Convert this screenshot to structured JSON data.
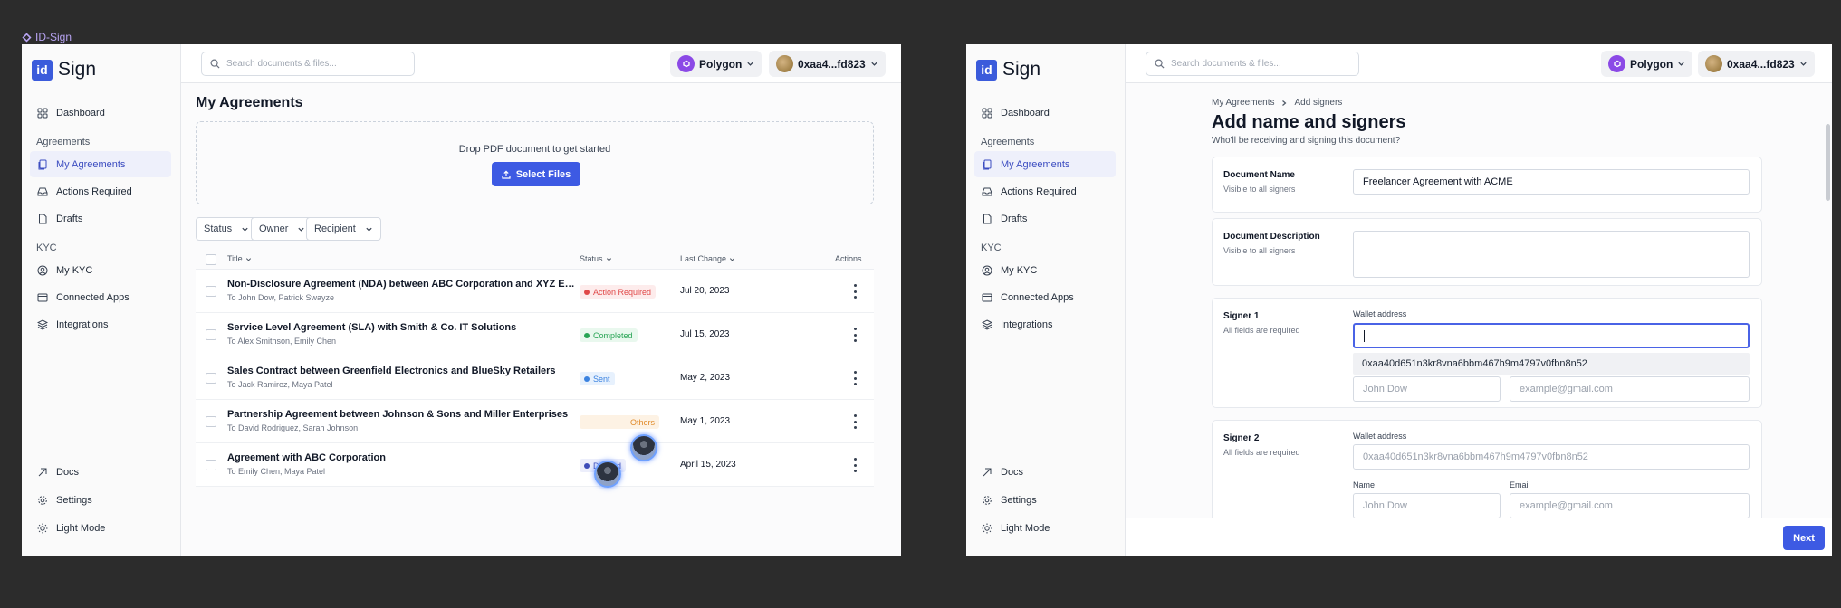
{
  "canvas": {
    "label": "ID-Sign"
  },
  "brand": {
    "logo_mark": "id",
    "logo_text": "Sign"
  },
  "search": {
    "placeholder": "Search documents & files..."
  },
  "network": {
    "label": "Polygon",
    "icon": "polygon-icon"
  },
  "wallet": {
    "label": "0xaa4...fd823"
  },
  "sidebar": {
    "dashboard": "Dashboard",
    "section_agreements": "Agreements",
    "my_agreements": "My Agreements",
    "actions_required": "Actions Required",
    "drafts": "Drafts",
    "section_kyc": "KYC",
    "my_kyc": "My KYC",
    "connected_apps": "Connected Apps",
    "integrations": "Integrations",
    "docs": "Docs",
    "settings": "Settings",
    "light_mode": "Light Mode"
  },
  "agreements_page": {
    "title": "My Agreements",
    "drop_text": "Drop PDF document to get started",
    "select_files": "Select Files",
    "filters": {
      "status": "Status",
      "owner": "Owner",
      "recipient": "Recipient"
    },
    "columns": {
      "title": "Title",
      "status": "Status",
      "last_change": "Last Change",
      "actions": "Actions"
    },
    "rows": [
      {
        "title": "Non-Disclosure Agreement (NDA) between ABC Corporation and XYZ Enterprises",
        "recipients": "To John Dow, Patrick Swayze",
        "status": "Action Required",
        "date": "Jul 20, 2023"
      },
      {
        "title": "Service Level Agreement (SLA) with Smith & Co. IT Solutions",
        "recipients": "To Alex Smithson, Emily Chen",
        "status": "Completed",
        "date": "Jul 15, 2023"
      },
      {
        "title": "Sales Contract between Greenfield Electronics and BlueSky Retailers",
        "recipients": "To Jack Ramirez, Maya Patel",
        "status": "Sent",
        "date": "May 2, 2023"
      },
      {
        "title": "Partnership Agreement between Johnson & Sons and Miller Enterprises",
        "recipients": "To David Rodriguez, Sarah Johnson",
        "status": "Others",
        "date": "May 1, 2023"
      },
      {
        "title": "Agreement with ABC Corporation",
        "recipients": "To Emily Chen, Maya Patel",
        "status": "Deleted",
        "date": "April 15, 2023"
      }
    ],
    "status_colors": {
      "action_required": {
        "bg": "#fdecec",
        "fg": "#e04848"
      },
      "completed": {
        "bg": "#e9f8ee",
        "fg": "#27a454"
      },
      "sent": {
        "bg": "#e7f1fd",
        "fg": "#3a82e0"
      },
      "others": {
        "bg": "#fdf2e4",
        "fg": "#e08a2a"
      },
      "deleted": {
        "bg": "#eceefb",
        "fg": "#3d4cb8"
      }
    }
  },
  "signers_page": {
    "breadcrumb_parent": "My Agreements",
    "breadcrumb_current": "Add signers",
    "title": "Add name and signers",
    "subtitle": "Who'll be receiving and signing this document?",
    "doc_name_label": "Document Name",
    "doc_name_hint": "Visible to all signers",
    "doc_name_value": "Freelancer Agreement with ACME",
    "doc_desc_label": "Document Description",
    "doc_desc_hint": "Visible to all signers",
    "signer1_label": "Signer 1",
    "signer2_label": "Signer 2",
    "signer_hint": "All fields are required",
    "wallet_label": "Wallet address",
    "wallet_placeholder": "0xaa40d651n3kr8vna6bbm467h9m4797v0fbn8n52",
    "wallet_suggestion": "0xaa40d651n3kr8vna6bbm467h9m4797v0fbn8n52",
    "name_label": "Name",
    "email_label": "Email",
    "name_placeholder": "John Dow",
    "email_placeholder": "example@gmail.com",
    "next": "Next"
  },
  "accent": "#3d5ae3"
}
